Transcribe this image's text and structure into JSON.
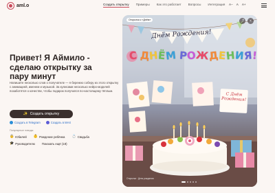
{
  "brand": {
    "name": "aml.o"
  },
  "nav": {
    "items": [
      {
        "label": "Создать открытку",
        "active": true
      },
      {
        "label": "Примеры",
        "active": false
      },
      {
        "label": "Как это работает",
        "active": false
      },
      {
        "label": "Вопросы",
        "active": false
      },
      {
        "label": "Интеграция",
        "active": false
      }
    ]
  },
  "font_controls": {
    "decrease": "A−",
    "reset": "A",
    "increase": "A+"
  },
  "hero": {
    "title": "Привет! Я Аймило - сделаю открытку за пару минут",
    "description": "Напишите несколько слов о получателе — я бережно соберу из этого открытку с анимацией, именем и музыкой. За кулисами несколько нейро-моделей позаботятся о качестве, чтобы подарок получился по-настоящему тёплым.",
    "cta_label": "Создать открытку",
    "links": [
      {
        "label": "Создать в Telegram"
      },
      {
        "label": "Создать в MAX"
      }
    ],
    "popular_title": "Популярные поводы:",
    "occasions": [
      {
        "emoji": "👵",
        "label": "Юбилей"
      },
      {
        "emoji": "👶",
        "label": "Рождение ребёнка"
      },
      {
        "emoji": "💍",
        "label": "Свадьба"
      },
      {
        "emoji": "🎓",
        "label": "Руководителю"
      },
      {
        "emoji": "",
        "label": "Показать ещё (18)"
      }
    ]
  },
  "card": {
    "badge": "Открытка к «Днём»",
    "banner": "Днём Рождения!",
    "rainbow": "С ДНЁМ РОЖДЕНИЯ!",
    "mini_card": "С Днём Рождения!",
    "caption": "Открытка · День рождения",
    "controls": [
      "share-icon",
      "close-icon"
    ],
    "slides": 5,
    "active_slide": 0
  },
  "colors": {
    "accent": "#c8495a",
    "cta_bg": "#3a2f2d",
    "link": "#2a6cc7",
    "page_bg": "#fbf6f3"
  }
}
